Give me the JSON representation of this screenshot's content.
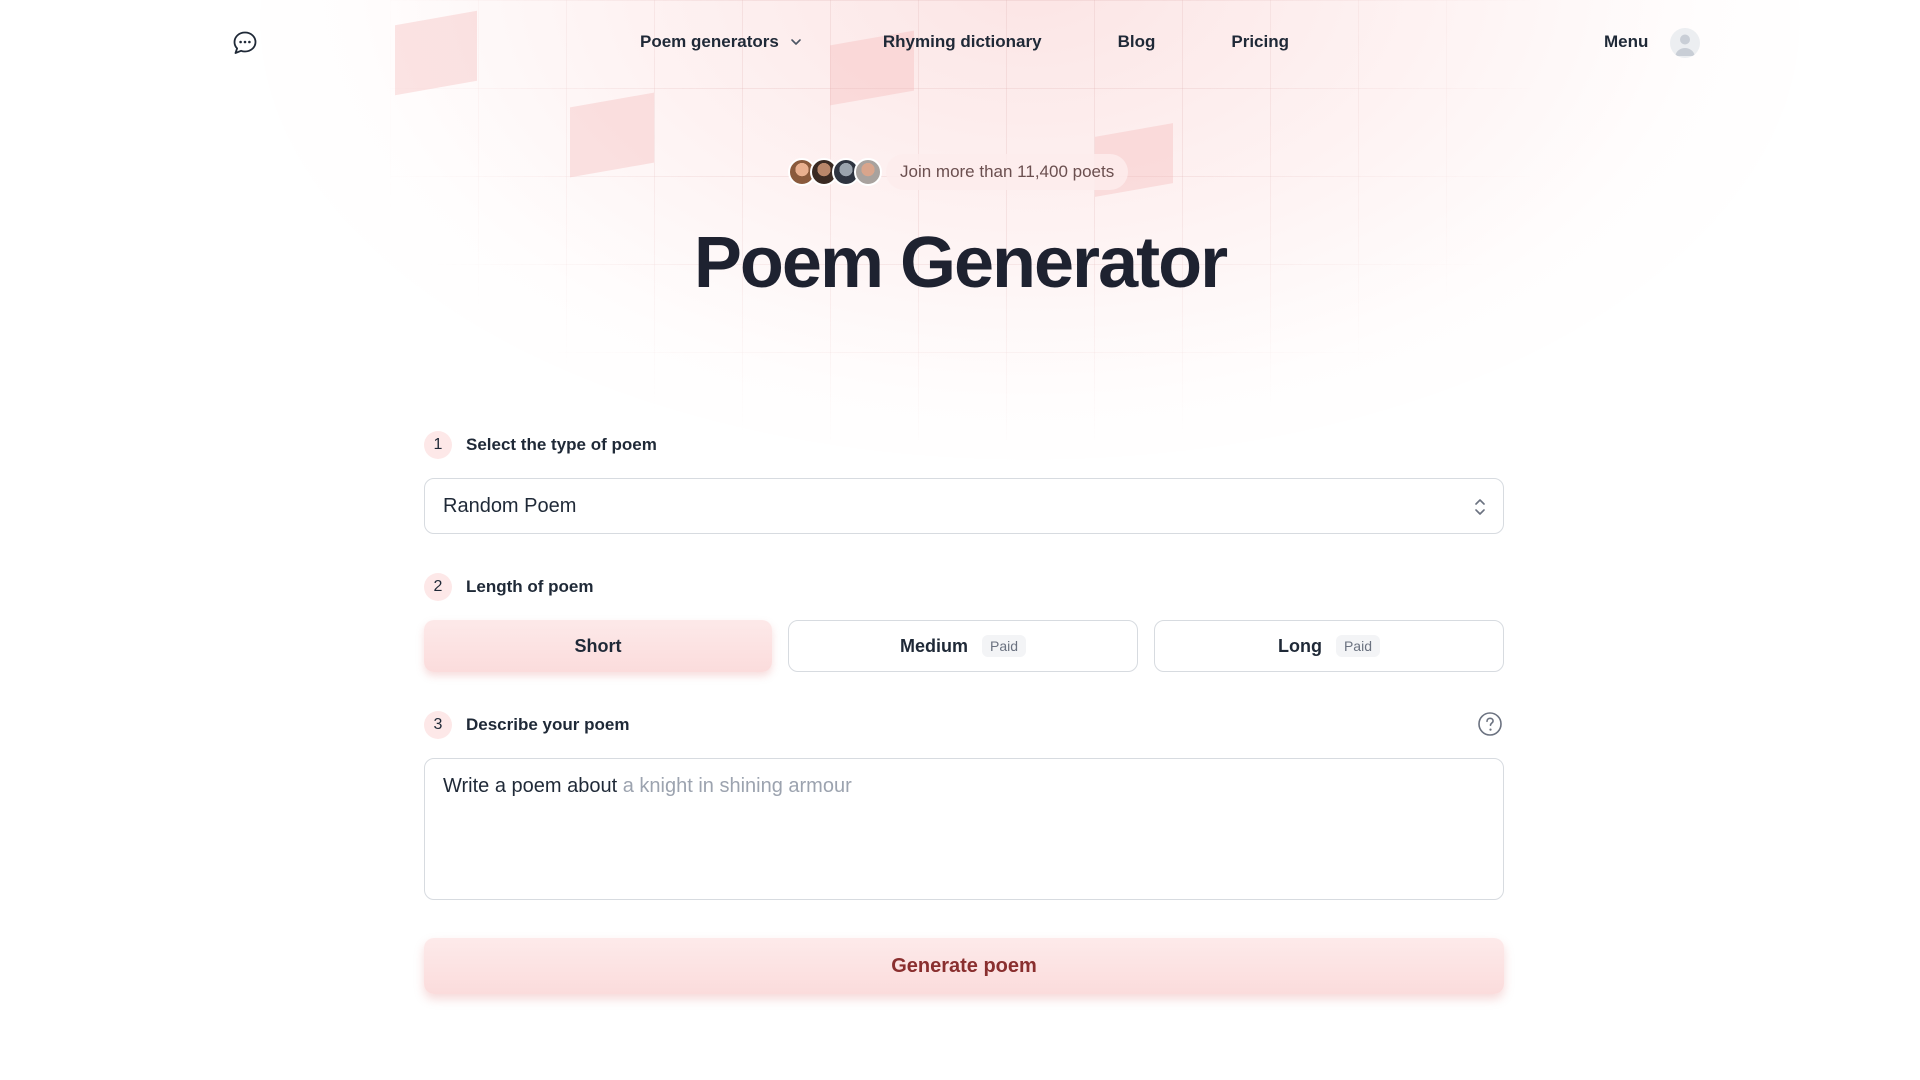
{
  "nav": {
    "logo_icon": "chat-bubble-icon",
    "links": [
      {
        "label": "Poem generators",
        "has_dropdown": true
      },
      {
        "label": "Rhyming dictionary"
      },
      {
        "label": "Blog"
      },
      {
        "label": "Pricing"
      }
    ],
    "menu_label": "Menu",
    "avatar_icon": "user-avatar-icon"
  },
  "hero": {
    "social_proof": "Join more than 11,400 poets",
    "title": "Poem Generator"
  },
  "form": {
    "step1": {
      "number": "1",
      "label": "Select the type of poem",
      "value": "Random Poem"
    },
    "step2": {
      "number": "2",
      "label": "Length of poem",
      "options": [
        {
          "label": "Short",
          "selected": true
        },
        {
          "label": "Medium",
          "badge": "Paid"
        },
        {
          "label": "Long",
          "badge": "Paid"
        }
      ]
    },
    "step3": {
      "number": "3",
      "label": "Describe your poem",
      "prefix": "Write a poem about",
      "placeholder": "a knight in shining armour"
    },
    "generate_label": "Generate poem"
  },
  "colors": {
    "accent_bg": "#fde8e8",
    "button_text": "#8a2f2f",
    "title": "#1e2230"
  }
}
